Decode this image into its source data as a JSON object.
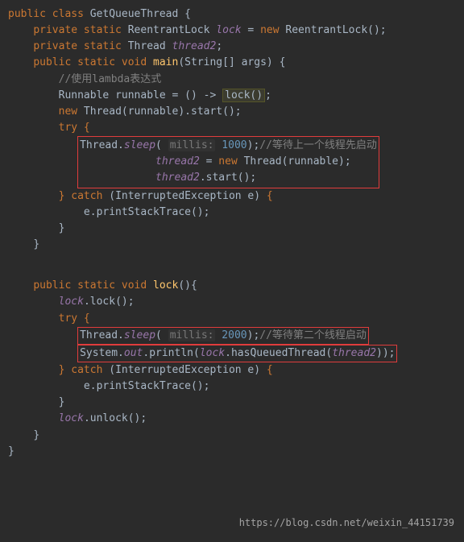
{
  "code": {
    "class_decl": {
      "mods": "public class",
      "name": "GetQueueThread",
      "brace": "{"
    },
    "field1": {
      "mods": "private static",
      "type": "ReentrantLock",
      "name": "lock",
      "op": " = ",
      "newkw": "new",
      "ctor": "ReentrantLock",
      "tail": "();"
    },
    "field2": {
      "mods": "private static",
      "type": "Thread",
      "name": "thread2",
      "tail": ";"
    },
    "main": {
      "mods": "public static void",
      "name": "main",
      "params": "(String[] args) {",
      "c1": "//使用lambda表达式",
      "l1a": "Runnable runnable = () -> ",
      "l1b": "lock()",
      "l1c": ";",
      "l2": {
        "newkw": "new",
        "rest": " Thread(runnable).start();"
      },
      "try": "try {",
      "sleep": {
        "a": "Thread.",
        "m": "sleep",
        "p": "( ",
        "hint": "millis:",
        "n": " 1000",
        "b": ");",
        "cmt": "//等待上一个线程先启动"
      },
      "l3": {
        "lhs": "thread2",
        "op": " = ",
        "newkw": "new",
        "rest": " Thread(runnable);"
      },
      "l4": {
        "o": "thread2",
        "rest": ".start();"
      },
      "catch": "} catch (InterruptedException e) {",
      "l5": "e.printStackTrace();",
      "end_try": "}",
      "end": "}"
    },
    "lock": {
      "sig": {
        "mods": "public static void",
        "name": "lock",
        "params": "(){"
      },
      "l1": {
        "o": "lock",
        "rest": ".lock();"
      },
      "try": "try {",
      "sleep": {
        "a": "Thread.",
        "m": "sleep",
        "p": "( ",
        "hint": "millis:",
        "n": " 2000",
        "b": ");",
        "cmt": "//等待第二个线程启动"
      },
      "print": {
        "a": "System.",
        "out": "out",
        "b": ".println(",
        "obj": "lock",
        "c": ".hasQueuedThread(",
        "arg": "thread2",
        "d": "));"
      },
      "catch": "} catch (InterruptedException e) {",
      "l2": "e.printStackTrace();",
      "end_try": "}",
      "unlock": {
        "o": "lock",
        "rest": ".unlock();"
      },
      "end": "}"
    },
    "close": "}"
  },
  "watermark": "https://blog.csdn.net/weixin_44151739"
}
